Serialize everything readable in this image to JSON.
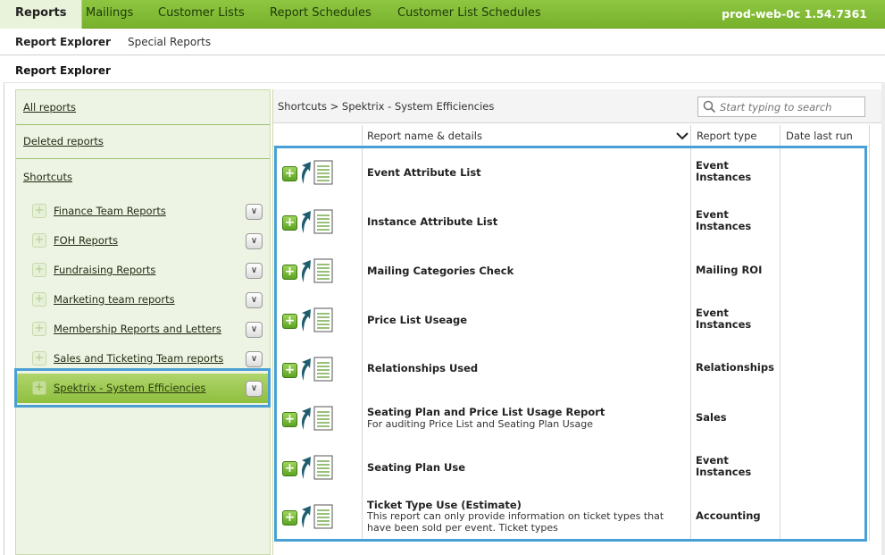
{
  "topnav": {
    "tabs": [
      {
        "label": "Reports",
        "active": true
      },
      {
        "label": "Mailings"
      },
      {
        "label": "Customer Lists"
      },
      {
        "label": "Report Schedules"
      },
      {
        "label": "Customer List Schedules"
      }
    ],
    "version": "prod-web-0c 1.54.7361"
  },
  "subnav": {
    "items": [
      {
        "label": "Report Explorer",
        "active": true
      },
      {
        "label": "Special Reports"
      }
    ]
  },
  "page_title": "Report Explorer",
  "sidebar": {
    "all_reports": "All reports",
    "deleted_reports": "Deleted reports",
    "shortcuts": "Shortcuts",
    "items": [
      {
        "label": "Finance Team Reports"
      },
      {
        "label": "FOH Reports"
      },
      {
        "label": "Fundraising Reports"
      },
      {
        "label": "Marketing team reports"
      },
      {
        "label": "Membership Reports and Letters"
      },
      {
        "label": "Sales and Ticketing Team reports"
      },
      {
        "label": "Spektrix - System Efficiencies",
        "selected": true
      }
    ]
  },
  "main": {
    "breadcrumb": "Shortcuts > Spektrix - System Efficiencies",
    "search_placeholder": "Start typing to search",
    "columns": {
      "name": "Report name & details",
      "type": "Report type",
      "date": "Date last run"
    },
    "rows": [
      {
        "name": "Event Attribute List",
        "desc": "",
        "type": "Event Instances"
      },
      {
        "name": "Instance Attribute List",
        "desc": "",
        "type": "Event Instances"
      },
      {
        "name": "Mailing Categories Check",
        "desc": "",
        "type": "Mailing ROI"
      },
      {
        "name": "Price List Useage",
        "desc": "",
        "type": "Event Instances"
      },
      {
        "name": "Relationships Used",
        "desc": "",
        "type": "Relationships"
      },
      {
        "name": "Seating Plan and Price List Usage Report",
        "desc": "For auditing Price List and Seating Plan Usage",
        "type": "Sales"
      },
      {
        "name": "Seating Plan Use",
        "desc": "",
        "type": "Event Instances"
      },
      {
        "name": "Ticket Type Use (Estimate)",
        "desc": "This report can only provide information on ticket types that have been sold per event. Ticket types",
        "type": "Accounting"
      }
    ]
  },
  "colors": {
    "brand_green": "#8ec641",
    "highlight_blue": "#4aa0d5"
  }
}
